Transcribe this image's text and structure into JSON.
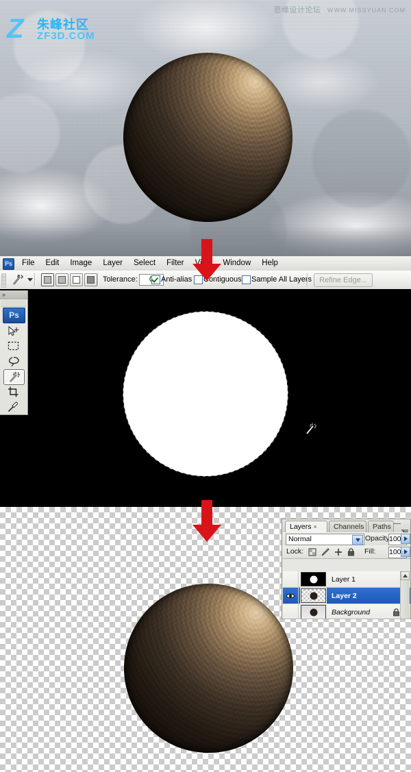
{
  "watermarks": {
    "top_right_cn": "思缘设计论坛",
    "top_right_url": "WWW.MISSYUAN.COM",
    "logo_mark": "Z",
    "logo_cn": "朱峰社区",
    "logo_url": "ZF3D.COM"
  },
  "menubar": {
    "app_badge": "Ps",
    "items": [
      "File",
      "Edit",
      "Image",
      "Layer",
      "Select",
      "Filter",
      "View",
      "Window",
      "Help"
    ]
  },
  "options_bar": {
    "tool_icon": "magic-wand-icon",
    "selection_modes": [
      "new-selection",
      "add-to-selection",
      "subtract-from-selection",
      "intersect-with-selection"
    ],
    "tolerance_label": "Tolerance:",
    "tolerance_value": "0",
    "anti_alias_label": "Anti-alias",
    "anti_alias_checked": true,
    "contiguous_label": "Contiguous",
    "contiguous_checked": false,
    "sample_all_layers_label": "Sample All Layers",
    "sample_all_layers_checked": false,
    "refine_edge_label": "Refine Edge...",
    "refine_edge_enabled": false
  },
  "tool_panel": {
    "collapse_icon": "double-chevron-right-icon",
    "app_badge": "Ps",
    "tools": [
      {
        "name": "move-tool",
        "active": false
      },
      {
        "name": "rectangular-marquee-tool",
        "active": false
      },
      {
        "name": "lasso-tool",
        "active": false
      },
      {
        "name": "magic-wand-tool",
        "active": true
      },
      {
        "name": "crop-tool",
        "active": false
      },
      {
        "name": "eyedropper-tool",
        "active": false
      }
    ]
  },
  "layers_panel": {
    "tabs": [
      {
        "label": "Layers",
        "active": true,
        "close": "×"
      },
      {
        "label": "Channels",
        "active": false
      },
      {
        "label": "Paths",
        "active": false
      }
    ],
    "blend_mode": "Normal",
    "opacity_label": "Opacity:",
    "opacity_value": "100%",
    "lock_label": "Lock:",
    "lock_icons": [
      "lock-transparent-pixels-icon",
      "lock-image-pixels-icon",
      "lock-position-icon",
      "lock-all-icon"
    ],
    "fill_label": "Fill:",
    "fill_value": "100%",
    "layers": [
      {
        "name": "Layer 1",
        "visible": false,
        "selected": false,
        "locked": false,
        "thumb": "white-circle-on-black",
        "italic": false
      },
      {
        "name": "Layer 2",
        "visible": true,
        "selected": true,
        "locked": false,
        "thumb": "dark-circle-on-checker",
        "italic": false
      },
      {
        "name": "Background",
        "visible": false,
        "selected": false,
        "locked": true,
        "thumb": "dark-circle-on-gray",
        "italic": true
      }
    ]
  },
  "annotations": {
    "arrow_1": "red-down-arrow-step-1",
    "arrow_2": "red-down-arrow-step-2",
    "arrow_color": "#d9131a"
  },
  "cursor": {
    "type": "magic-wand-cursor"
  },
  "canvas": {
    "top_image": "sphere-over-clouds",
    "middle_image": "white-circle-selection-on-black",
    "bottom_image": "sphere-on-transparent-background"
  }
}
